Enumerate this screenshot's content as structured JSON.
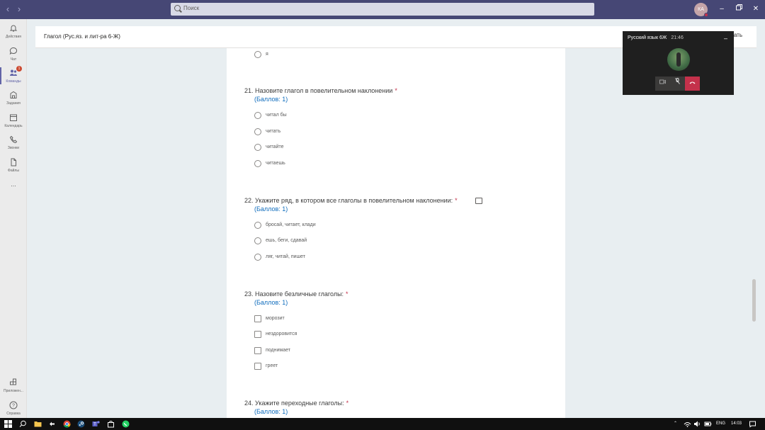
{
  "search": {
    "placeholder": "Поиск"
  },
  "user": {
    "initials": "КА"
  },
  "rail": {
    "items": [
      {
        "label": "Действия",
        "icon": "bell-icon"
      },
      {
        "label": "Чат",
        "icon": "chat-icon"
      },
      {
        "label": "Команды",
        "icon": "teams-icon",
        "badge": "1",
        "active": true
      },
      {
        "label": "Задания",
        "icon": "assignments-icon"
      },
      {
        "label": "Календарь",
        "icon": "calendar-icon"
      },
      {
        "label": "Звонки",
        "icon": "phone-icon"
      },
      {
        "label": "Файлы",
        "icon": "file-icon"
      }
    ],
    "more": "...",
    "apps_label": "Приложен...",
    "help_label": "Справка"
  },
  "header": {
    "title": "Глагол (Рус.яз. и лит-ра 6-Ж)",
    "button": "ать"
  },
  "form": {
    "top_option": "я",
    "questions": [
      {
        "title": "21. Назовите глагол в повелительном наклонении",
        "required": "*",
        "score": "(Баллов: 1)",
        "type": "radio",
        "options": [
          "читал бы",
          "читать",
          "читайте",
          "читаешь"
        ]
      },
      {
        "title": "22. Укажите ряд, в котором все глаголы в повелительном наклонении:",
        "required": "*",
        "score": "(Баллов: 1)",
        "type": "radio",
        "options": [
          "бросай, читает, клади",
          "ешь, беги, сдавай",
          "ляг, читай, пишет"
        ]
      },
      {
        "title": "23. Назовите безличные глаголы:",
        "required": "*",
        "score": "(Баллов: 1)",
        "type": "checkbox",
        "options": [
          "морозит",
          "нездоровится",
          "поднимает",
          "греет"
        ]
      },
      {
        "title": "24. Укажите переходные глаголы:",
        "required": "*",
        "score": "(Баллов: 1)",
        "type": "checkbox",
        "options": []
      }
    ]
  },
  "call": {
    "title": "Русский язык 6Ж",
    "time": "21:46",
    "minimize": "–"
  },
  "taskbar": {
    "lang": "ENG",
    "time": "14:03"
  },
  "colors": {
    "titlebar": "#464775",
    "accent": "#6264a7",
    "score": "#0f6cbd",
    "required": "#c4314b",
    "hangup": "#c4314b"
  }
}
